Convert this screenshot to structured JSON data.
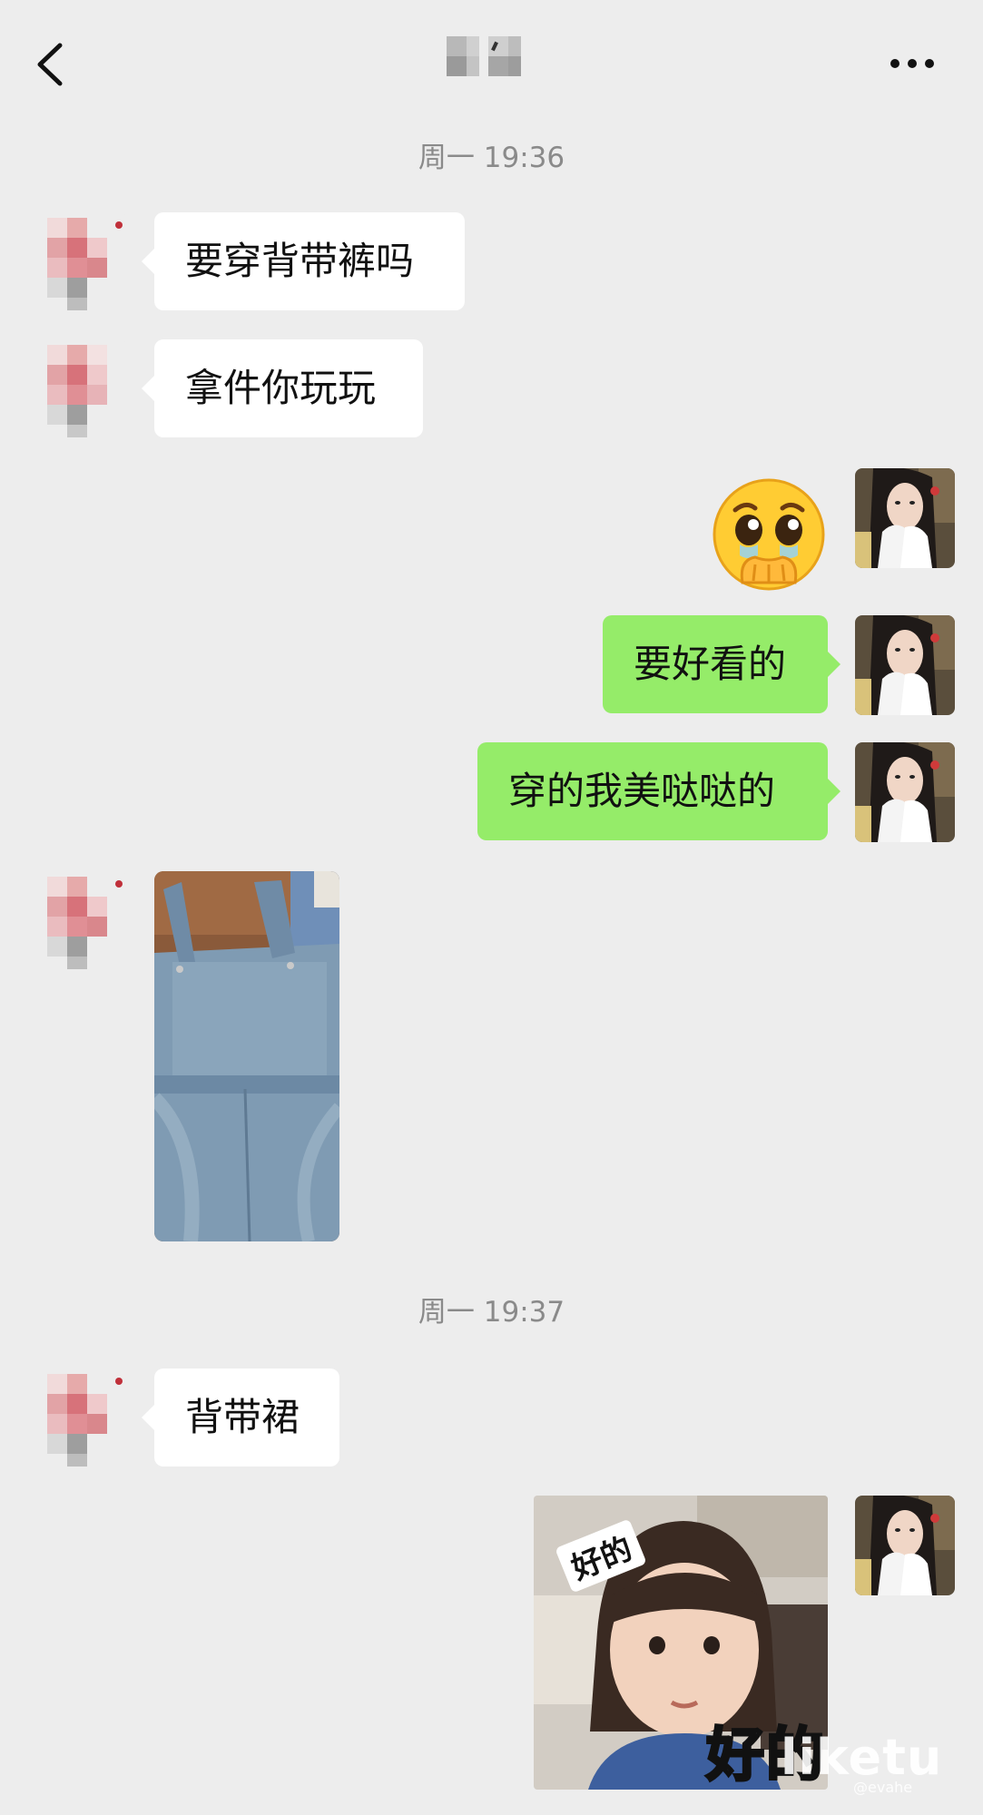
{
  "header": {
    "back_icon": "chevron-left-icon",
    "more_icon": "ellipsis-icon"
  },
  "timestamps": [
    "周一 19:36",
    "周一 19:37"
  ],
  "messages": [
    {
      "side": "left",
      "type": "text",
      "text": "要穿背带裤吗"
    },
    {
      "side": "left",
      "type": "text",
      "text": "拿件你玩玩"
    },
    {
      "side": "right",
      "type": "emoji",
      "emoji": "🥹"
    },
    {
      "side": "right",
      "type": "text",
      "text": "要好看的"
    },
    {
      "side": "right",
      "type": "text",
      "text": "穿的我美哒哒的"
    },
    {
      "side": "left",
      "type": "image",
      "description_icon": "denim-overalls-photo"
    },
    {
      "side": "left",
      "type": "text",
      "text": "背带裙"
    },
    {
      "side": "right",
      "type": "sticker",
      "small_text": "好的",
      "big_text": "好的"
    }
  ],
  "watermark": {
    "main": "liketu",
    "sub": "@evahe"
  },
  "colors": {
    "background": "#ededed",
    "bubble_left": "#ffffff",
    "bubble_right": "#95ec69",
    "timestamp": "#8a8a8a"
  }
}
